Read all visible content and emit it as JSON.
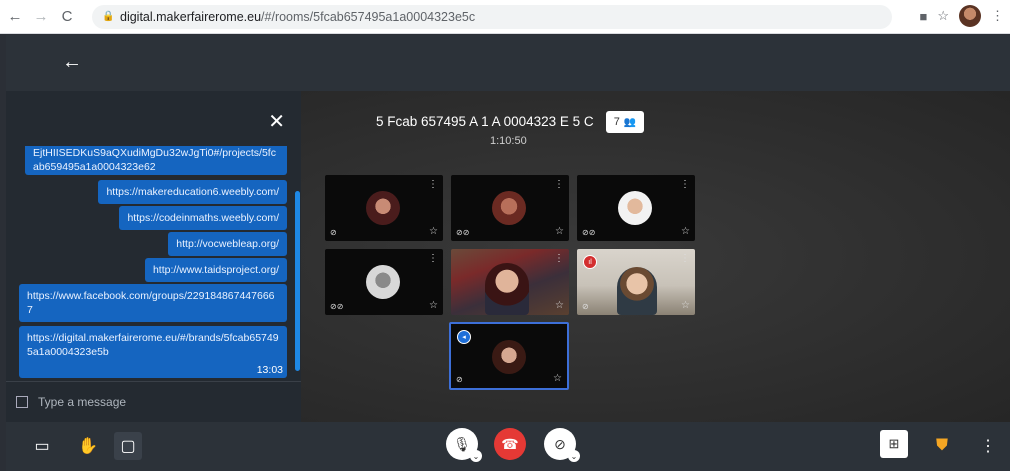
{
  "browser": {
    "back": "←",
    "forward": "→",
    "reload": "C",
    "url_host": "digital.makerfairerome.eu",
    "url_path": "/#/rooms/5fcab657495a1a0004323e5c",
    "icons": [
      "video-camera-icon",
      "star-icon",
      "profile-avatar-icon",
      "kebab-menu-icon"
    ]
  },
  "header": {
    "back_icon": "←"
  },
  "chat": {
    "close_icon": "✕",
    "messages": [
      {
        "text": "EjtHIISEDKuS9aQXudiMgDu32wJgTi0#/projects/5fcab659495a1a0004323e62"
      },
      {
        "text": "https://makereducation6.weebly.com/"
      },
      {
        "text": "https://codeinmaths.weebly.com/"
      },
      {
        "text": "http://vocwebleap.org/"
      },
      {
        "text": "http://www.taidsproject.org/"
      },
      {
        "text": "https://www.facebook.com/groups/2291848674476667"
      },
      {
        "text": "https://digital.makerfairerome.eu/#/brands/5fcab657495a1a0004323e5b"
      }
    ],
    "time": "13:03",
    "input_placeholder": "Type a message"
  },
  "stage": {
    "room_title": "5 Fcab 657495 A 1 A 0004323 E 5 C",
    "participant_count": "7",
    "timer": "1:10:50",
    "tiles": [
      {
        "type": "avatar",
        "active": false
      },
      {
        "type": "avatar",
        "active": false
      },
      {
        "type": "avatar",
        "active": false
      },
      {
        "type": "avatar",
        "active": false
      },
      {
        "type": "video",
        "active": false
      },
      {
        "type": "video",
        "active": false
      },
      {
        "type": "avatar",
        "active": true
      }
    ]
  },
  "toolbar": {
    "left_icons": [
      "screen-share-icon",
      "raise-hand-icon",
      "chat-icon"
    ],
    "center_icons": [
      "microphone-icon",
      "hangup-icon",
      "camera-off-icon"
    ],
    "right_icons": [
      "tile-view-icon",
      "security-shield-icon",
      "more-options-icon"
    ]
  },
  "colors": {
    "accent": "#1565c0",
    "hangup": "#e53935",
    "panel": "#242a31"
  }
}
